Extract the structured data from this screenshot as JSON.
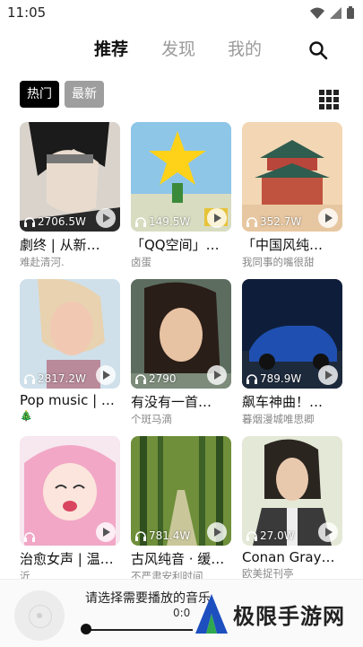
{
  "status_bar": {
    "time": "11:05"
  },
  "nav": {
    "tabs": [
      "推荐",
      "发现",
      "我的"
    ]
  },
  "filters": [
    "热门",
    "最新"
  ],
  "albums": [
    {
      "title": "劇终 | 从新…",
      "subtitle": "难赴清河.",
      "plays": "2706.5W"
    },
    {
      "title": "「QQ空间」…",
      "subtitle": "卤蛋",
      "plays": "149.5W"
    },
    {
      "title": "「中国风纯…",
      "subtitle": "我同事的嘴很甜",
      "plays": "352.7W"
    },
    {
      "title": "Pop music | …",
      "subtitle": "🎄",
      "plays": "2817.2W"
    },
    {
      "title": "有没有一首…",
      "subtitle": "个斑马滴",
      "plays": "2790"
    },
    {
      "title": "飙车神曲！…",
      "subtitle": "暮烟漫城唯思卿",
      "plays": "789.9W"
    },
    {
      "title": "治愈女声 | 温…",
      "subtitle": "沂",
      "plays": ""
    },
    {
      "title": "古风纯音 · 缓…",
      "subtitle": "不严肃安利时间",
      "plays": "781.4W"
    },
    {
      "title": "Conan Gray…",
      "subtitle": "欧美捉刊亭",
      "plays": "27.0W"
    }
  ],
  "player": {
    "title": "请选择需要播放的音乐",
    "time": "0:0",
    "progress": 0
  },
  "watermark": {
    "text": "极限手游网"
  },
  "colors": {
    "active_chip": "#000000",
    "inactive_chip": "#9e9e9e",
    "tab_inactive": "#9a9a9a"
  }
}
